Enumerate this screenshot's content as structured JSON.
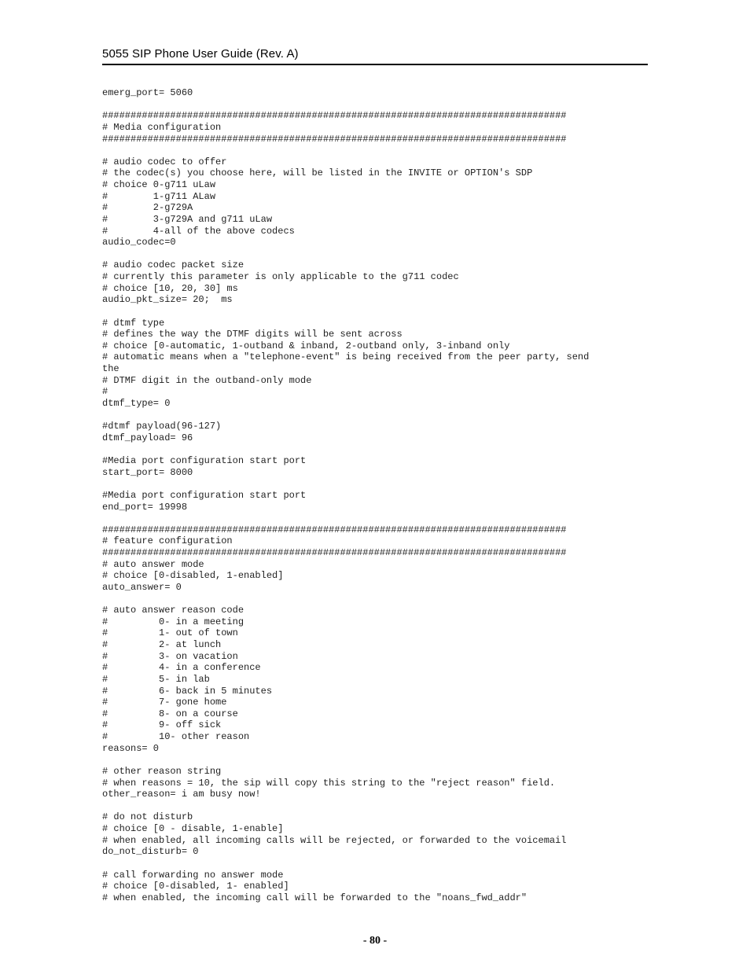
{
  "header": {
    "title": "5055 SIP Phone User Guide (Rev. A)"
  },
  "code_text": "emerg_port= 5060\n\n##################################################################################\n# Media configuration\n##################################################################################\n\n# audio codec to offer\n# the codec(s) you choose here, will be listed in the INVITE or OPTION's SDP\n# choice 0-g711 uLaw\n#        1-g711 ALaw\n#        2-g729A\n#        3-g729A and g711 uLaw\n#        4-all of the above codecs\naudio_codec=0\n\n# audio codec packet size\n# currently this parameter is only applicable to the g711 codec\n# choice [10, 20, 30] ms\naudio_pkt_size= 20;  ms\n\n# dtmf type\n# defines the way the DTMF digits will be sent across\n# choice [0-automatic, 1-outband & inband, 2-outband only, 3-inband only\n# automatic means when a \"telephone-event\" is being received from the peer party, send\nthe\n# DTMF digit in the outband-only mode\n#\ndtmf_type= 0\n\n#dtmf payload(96-127)\ndtmf_payload= 96\n\n#Media port configuration start port\nstart_port= 8000\n\n#Media port configuration start port\nend_port= 19998\n\n##################################################################################\n# feature configuration\n##################################################################################\n# auto answer mode\n# choice [0-disabled, 1-enabled]\nauto_answer= 0\n\n# auto answer reason code\n#         0- in a meeting\n#         1- out of town\n#         2- at lunch\n#         3- on vacation\n#         4- in a conference\n#         5- in lab\n#         6- back in 5 minutes\n#         7- gone home\n#         8- on a course\n#         9- off sick\n#         10- other reason\nreasons= 0\n\n# other reason string\n# when reasons = 10, the sip will copy this string to the \"reject reason\" field.\nother_reason= i am busy now!\n\n# do not disturb\n# choice [0 - disable, 1-enable]\n# when enabled, all incoming calls will be rejected, or forwarded to the voicemail\ndo_not_disturb= 0\n\n# call forwarding no answer mode\n# choice [0-disabled, 1- enabled]\n# when enabled, the incoming call will be forwarded to the \"noans_fwd_addr\"",
  "footer": {
    "page_number": "- 80 -"
  }
}
